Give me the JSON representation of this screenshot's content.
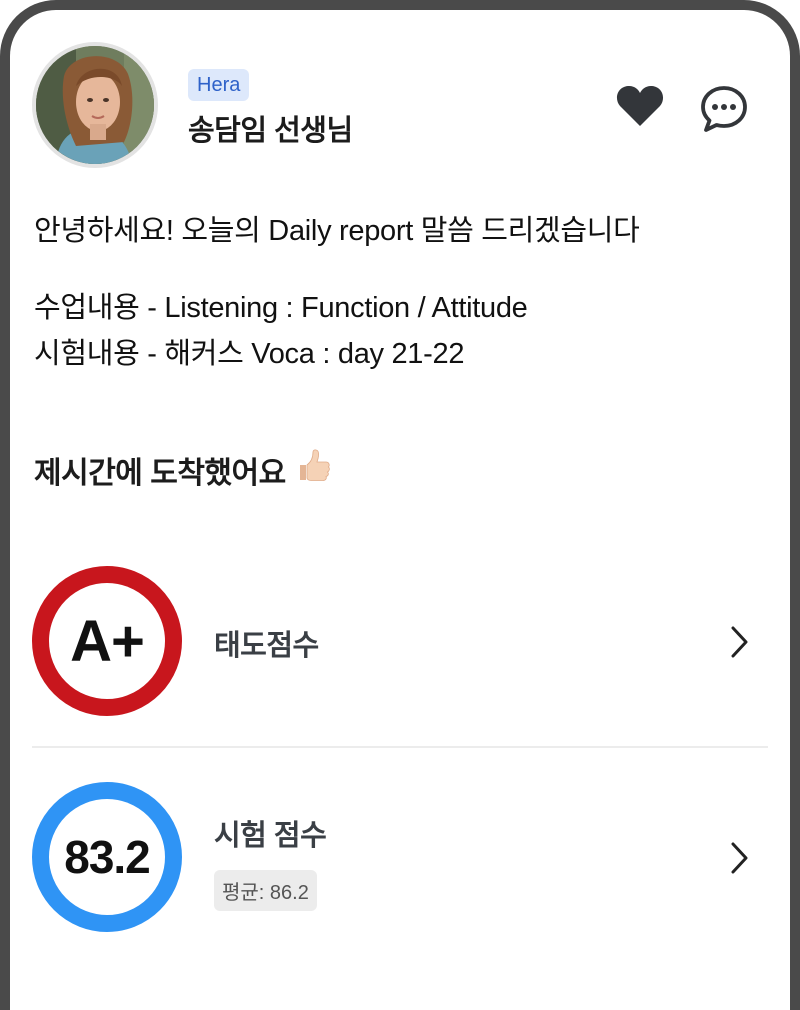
{
  "teacher": {
    "tag": "Hera",
    "name": "송담임 선생님"
  },
  "actions": {
    "like_icon": "heart-icon",
    "chat_icon": "chat-bubble-icon"
  },
  "message": {
    "greeting": "안녕하세요! 오늘의 Daily report 말씀 드리겠습니다",
    "lesson": "수업내용 - Listening : Function / Attitude",
    "test": "시험내용 - 해커스 Voca : day 21-22"
  },
  "arrival": {
    "text": "제시간에 도착했어요",
    "emoji": "👍🏻"
  },
  "scores": {
    "attitude": {
      "grade": "A+",
      "label": "태도점수",
      "color": "#c8161d"
    },
    "test": {
      "value": "83.2",
      "label": "시험 점수",
      "average": "평균: 86.2",
      "color": "#2f94f5"
    }
  }
}
